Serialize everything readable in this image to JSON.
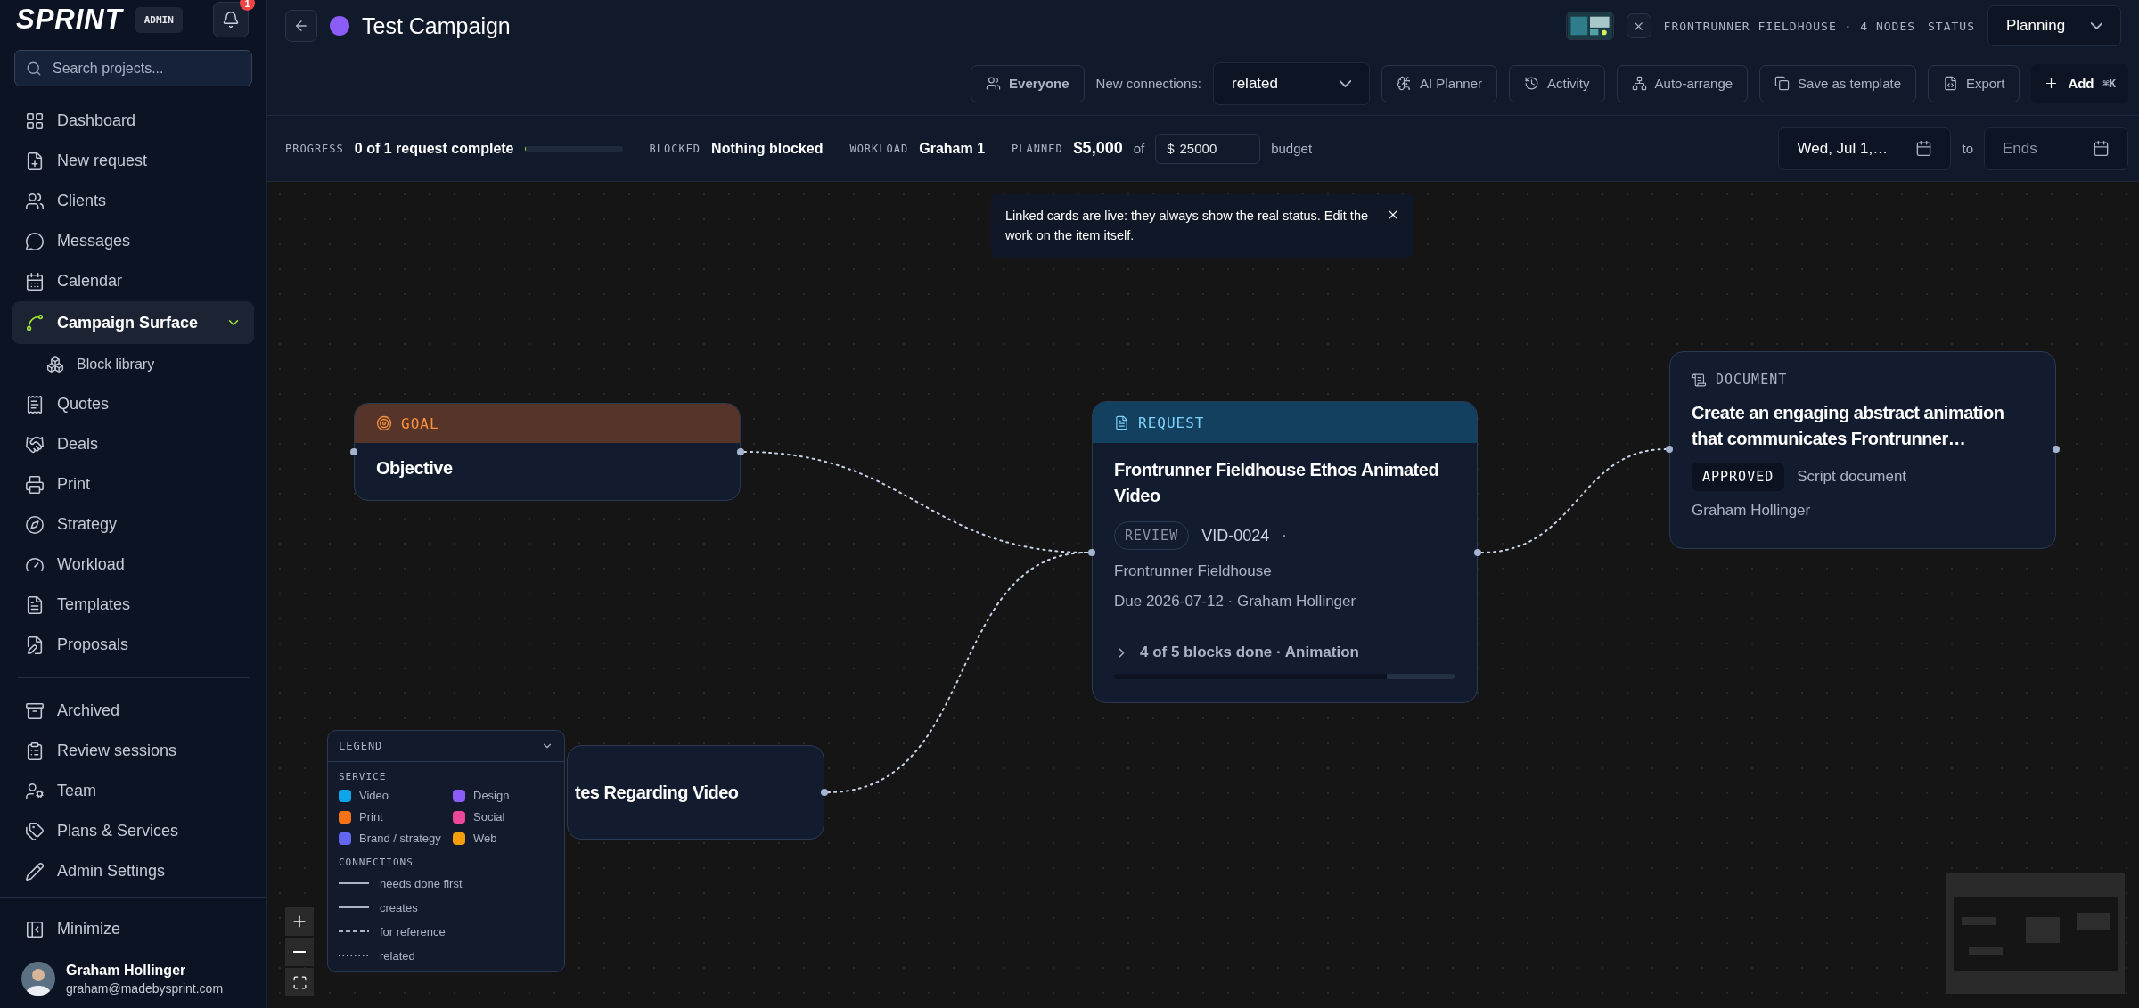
{
  "sidebar": {
    "logo": "SPRINT",
    "role_badge": "ADMIN",
    "notification_count": "1",
    "search": {
      "placeholder": "Search projects..."
    },
    "groups": [
      {
        "items": [
          {
            "label": "Dashboard",
            "selected": false
          },
          {
            "label": "New request",
            "selected": false
          },
          {
            "label": "Clients",
            "selected": false
          },
          {
            "label": "Messages",
            "selected": false
          },
          {
            "label": "Calendar",
            "selected": false
          },
          {
            "label": "Campaign Surface",
            "selected": true,
            "expanded": true,
            "children": [
              {
                "label": "Block library",
                "selected": false
              }
            ]
          },
          {
            "label": "Quotes",
            "selected": false
          },
          {
            "label": "Deals",
            "selected": false
          },
          {
            "label": "Print",
            "selected": false
          },
          {
            "label": "Strategy",
            "selected": false
          },
          {
            "label": "Workload",
            "selected": false
          },
          {
            "label": "Templates",
            "selected": false
          },
          {
            "label": "Proposals",
            "selected": false
          }
        ]
      },
      {
        "items": [
          {
            "label": "Archived",
            "selected": false
          },
          {
            "label": "Review sessions",
            "selected": false
          },
          {
            "label": "Team",
            "selected": false
          },
          {
            "label": "Plans & Services",
            "selected": false
          },
          {
            "label": "Admin Settings",
            "selected": false
          }
        ]
      }
    ],
    "minimize": "Minimize",
    "user": {
      "name": "Graham Hollinger",
      "email": "graham@madebysprint.com"
    }
  },
  "header": {
    "title": "Test Campaign",
    "summary": "FRONTRUNNER FIELDHOUSE · 4 NODES",
    "status_label": "STATUS",
    "status": "Planning"
  },
  "toolbar": {
    "audience": "Everyone",
    "connections_label": "New connections:",
    "connections_value": "related",
    "buttons": [
      "AI Planner",
      "Activity",
      "Auto-arrange",
      "Save as template",
      "Export"
    ],
    "add": {
      "label": "Add",
      "shortcut": "⌘K"
    }
  },
  "stats": {
    "progress": {
      "label": "PROGRESS",
      "value": "0 of 1 request complete",
      "level": 0
    },
    "blocked": {
      "label": "BLOCKED",
      "value": "Nothing blocked"
    },
    "workload": {
      "label": "WORKLOAD",
      "value": "Graham 1"
    },
    "planned": {
      "label": "PLANNED",
      "value": "$5,000",
      "of": "of",
      "currency": "$",
      "budget": "25000",
      "suffix": "budget"
    },
    "dates": {
      "start": "Wed, Jul 1,…",
      "to": "to",
      "end_placeholder": "Ends"
    }
  },
  "canvas": {
    "toast": "Linked cards are live: they always show the real status. Edit the work on the item itself.",
    "nodes": [
      {
        "kind": "goal",
        "type_label": "GOAL",
        "title": "Objective"
      },
      {
        "kind": "request",
        "type_label": "REQUEST",
        "title": "Frontrunner Fieldhouse Ethos Animated Video",
        "status": "REVIEW",
        "code": "VID-0024",
        "separator": "·",
        "client": "Frontrunner Fieldhouse",
        "due": "Due 2026-07-12 · Graham Hollinger",
        "blocks": "4 of 5 blocks done · Animation",
        "expanded": false,
        "level": 0.8
      },
      {
        "kind": "document",
        "type_label": "DOCUMENT",
        "title": "Create an engaging abstract animation that communicates Frontrunner…",
        "status": "APPROVED",
        "doc_type": "Script document",
        "owner": "Graham Hollinger"
      },
      {
        "kind": "partial",
        "title": "tes Regarding Video"
      }
    ],
    "legend": {
      "title": "LEGEND",
      "expanded": true,
      "service_label": "SERVICE",
      "services": [
        {
          "label": "Video",
          "color": "#0ea5e9"
        },
        {
          "label": "Design",
          "color": "#8b5cf6"
        },
        {
          "label": "Print",
          "color": "#f97316"
        },
        {
          "label": "Social",
          "color": "#ec4899"
        },
        {
          "label": "Brand / strategy",
          "color": "#6366f1"
        },
        {
          "label": "Web",
          "color": "#f59e0b"
        }
      ],
      "connections_label": "CONNECTIONS",
      "connections": [
        {
          "label": "needs done first",
          "kind": "solid"
        },
        {
          "label": "creates",
          "kind": "solid"
        },
        {
          "label": "for reference",
          "kind": "dashed"
        },
        {
          "label": "related",
          "kind": "dotted"
        }
      ]
    }
  }
}
